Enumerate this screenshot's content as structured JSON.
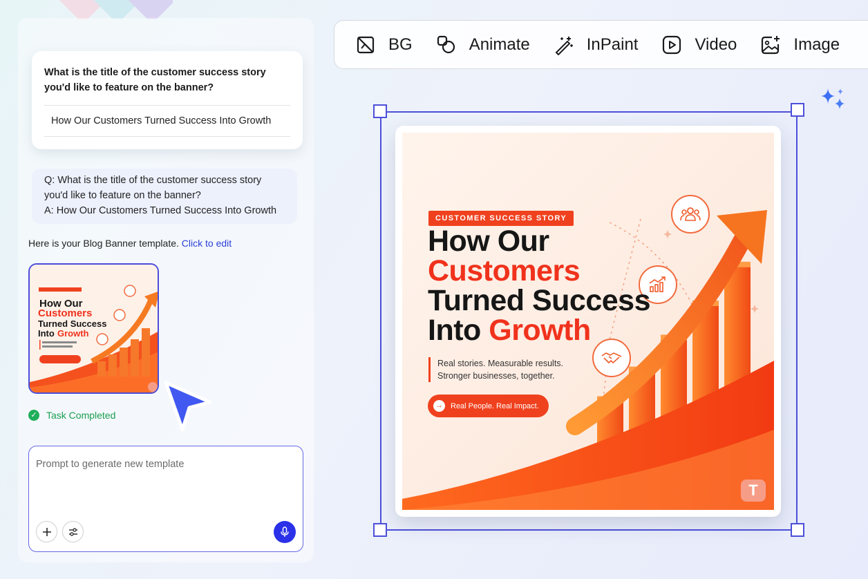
{
  "chat": {
    "question": "What is the title of the customer success story you'd like to feature on the banner?",
    "answer_option": "How Our Customers Turned Success Into Growth",
    "qa_question": "Q: What is the title of the customer success story you'd like to feature on the banner?",
    "qa_answer": "A: How Our Customers Turned Success Into Growth",
    "template_intro": "Here is your Blog Banner  template.",
    "edit_link": "Click to edit",
    "status": "Task Completed"
  },
  "prompt": {
    "placeholder": "Prompt to generate new template"
  },
  "toolbar": {
    "items": [
      {
        "label": "BG",
        "icon": "remove-background-icon"
      },
      {
        "label": "Animate",
        "icon": "animate-icon"
      },
      {
        "label": "InPaint",
        "icon": "magic-wand-icon"
      },
      {
        "label": "Video",
        "icon": "video-play-icon"
      },
      {
        "label": "Image",
        "icon": "image-add-icon"
      }
    ]
  },
  "banner": {
    "badge": "CUSTOMER SUCCESS STORY",
    "line1": "How Our",
    "line2": "Customers",
    "line3": "Turned Success",
    "line4_a": "Into ",
    "line4_b": "Growth",
    "sub1": "Real stories. Measurable results.",
    "sub2": "Stronger businesses, together.",
    "cta": "Real People. Real Impact.",
    "logo": "T",
    "bar_levels": [
      0.25,
      0.38,
      0.52,
      0.67,
      0.84
    ],
    "colors": {
      "accent": "#f0411e",
      "selection": "#4c4fd9"
    }
  }
}
